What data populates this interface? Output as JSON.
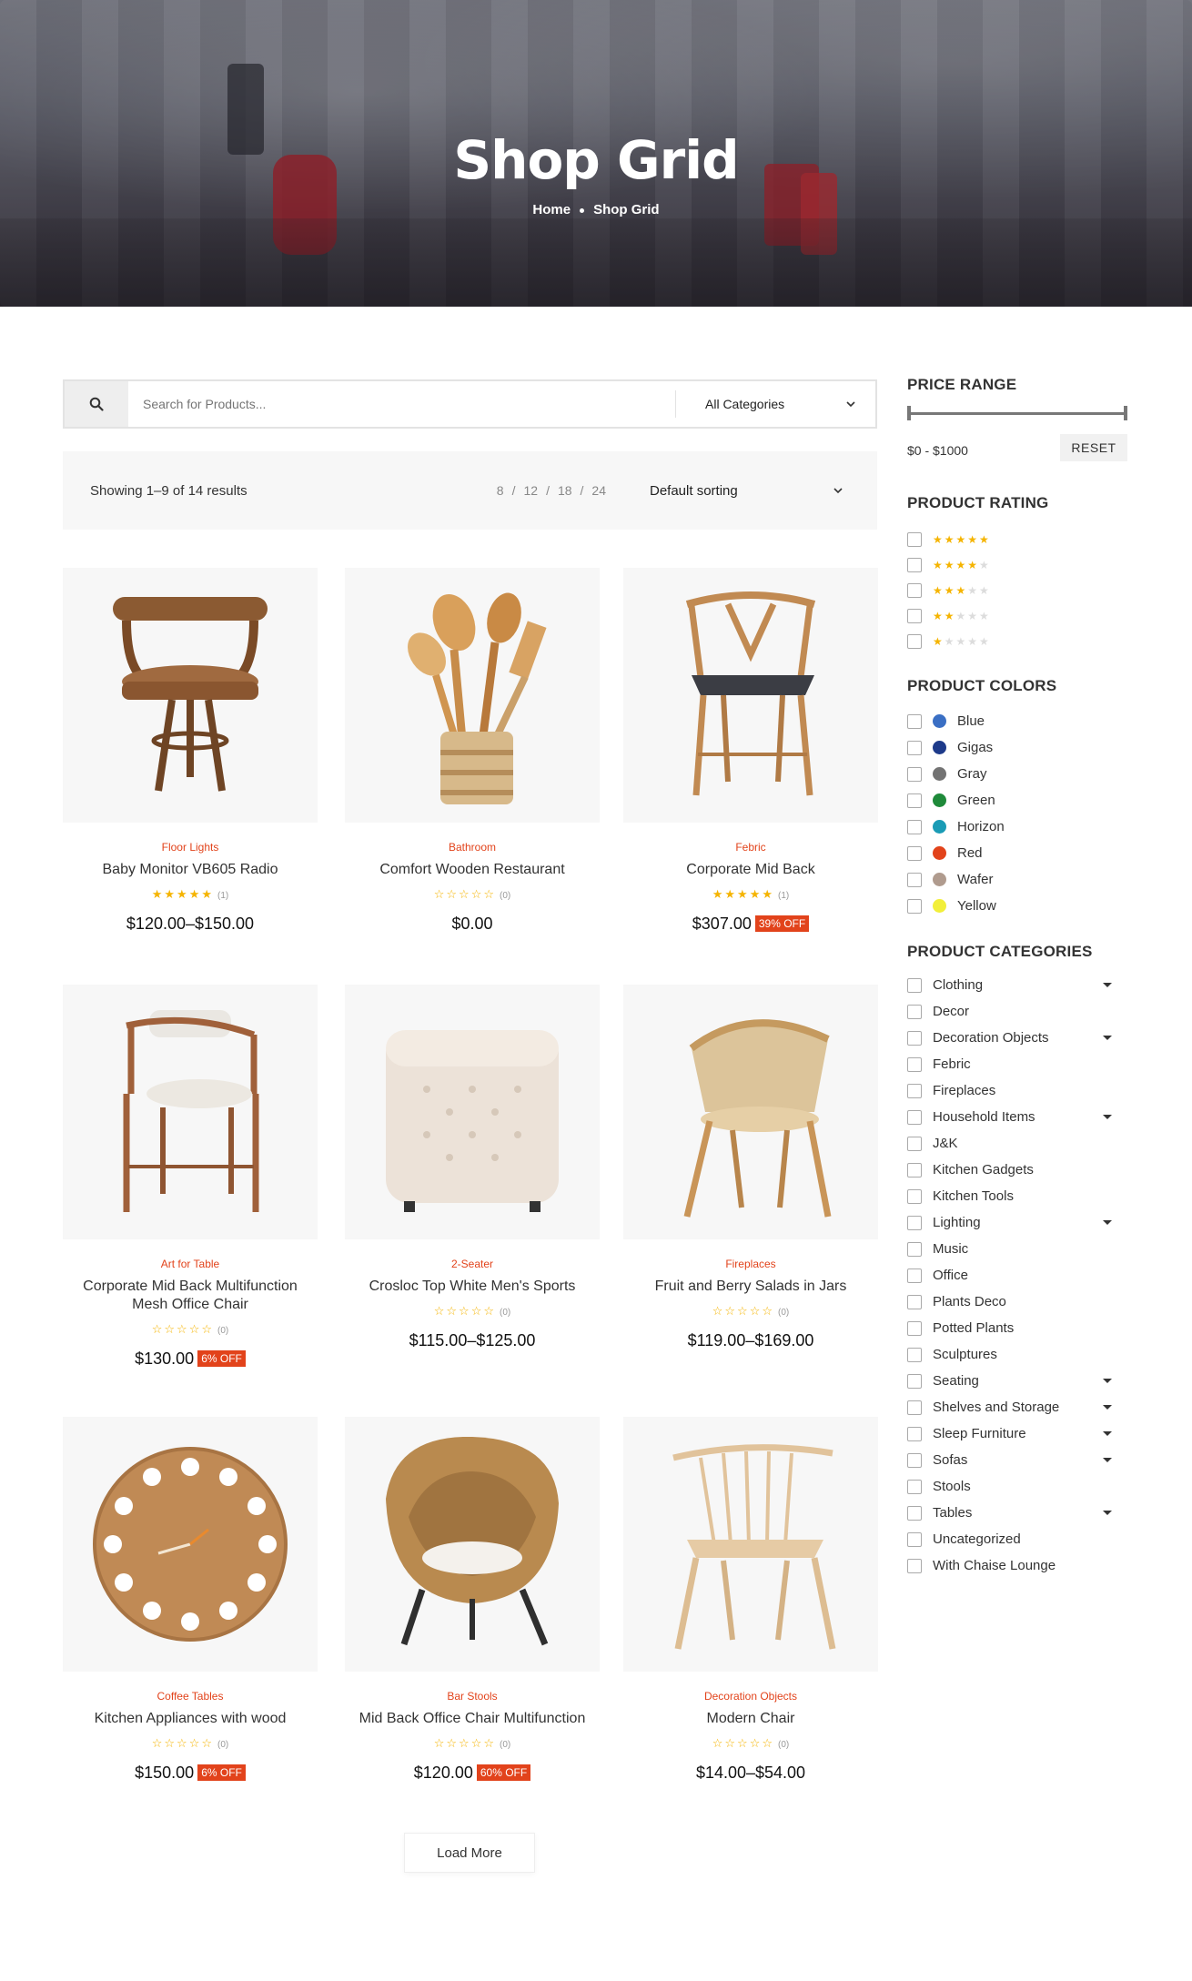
{
  "hero": {
    "title": "Shop Grid",
    "breadcrumb": [
      "Home",
      "Shop Grid"
    ]
  },
  "search": {
    "placeholder": "Search for Products...",
    "category": "All Categories"
  },
  "toolbar": {
    "showing": "Showing 1–9 of 14 results",
    "per_page": [
      "8",
      "12",
      "18",
      "24"
    ],
    "per_page_sep": "/",
    "sorting": "Default sorting"
  },
  "products": [
    {
      "category": "Floor Lights",
      "name": "Baby Monitor VB605 Radio",
      "stars": "★★★★★",
      "rating_count": "(1)",
      "price": "$120.00–$150.00",
      "badge": ""
    },
    {
      "category": "Bathroom",
      "name": "Comfort Wooden Restaurant",
      "stars": "☆☆☆☆☆",
      "rating_count": "(0)",
      "price": "$0.00",
      "badge": ""
    },
    {
      "category": "Febric",
      "name": "Corporate Mid Back",
      "stars": "★★★★★",
      "rating_count": "(1)",
      "price": "$307.00",
      "badge": "39% OFF"
    },
    {
      "category": "Art for Table",
      "name": "Corporate Mid Back Multifunction Mesh Office Chair",
      "stars": "☆☆☆☆☆",
      "rating_count": "(0)",
      "price": "$130.00",
      "badge": "6% OFF"
    },
    {
      "category": "2-Seater",
      "name": "Crosloc Top White Men's Sports",
      "stars": "☆☆☆☆☆",
      "rating_count": "(0)",
      "price": "$115.00–$125.00",
      "badge": ""
    },
    {
      "category": "Fireplaces",
      "name": "Fruit and Berry Salads in Jars",
      "stars": "☆☆☆☆☆",
      "rating_count": "(0)",
      "price": "$119.00–$169.00",
      "badge": ""
    },
    {
      "category": "Coffee Tables",
      "name": "Kitchen Appliances with wood",
      "stars": "☆☆☆☆☆",
      "rating_count": "(0)",
      "price": "$150.00",
      "badge": "6% OFF"
    },
    {
      "category": "Bar Stools",
      "name": "Mid Back Office Chair Multifunction",
      "stars": "☆☆☆☆☆",
      "rating_count": "(0)",
      "price": "$120.00",
      "badge": "60% OFF"
    },
    {
      "category": "Decoration Objects",
      "name": "Modern Chair",
      "stars": "☆☆☆☆☆",
      "rating_count": "(0)",
      "price": "$14.00–$54.00",
      "badge": ""
    }
  ],
  "load_more": "Load More",
  "sidebar": {
    "price_range": {
      "title": "PRICE RANGE",
      "text": "$0 - $1000",
      "reset": "RESET"
    },
    "rating": {
      "title": "PRODUCT RATING",
      "levels": [
        5,
        4,
        3,
        2,
        1
      ]
    },
    "colors": {
      "title": "PRODUCT COLORS",
      "items": [
        {
          "name": "Blue",
          "hex": "#3a6fc4"
        },
        {
          "name": "Gigas",
          "hex": "#1d3a8a"
        },
        {
          "name": "Gray",
          "hex": "#737373"
        },
        {
          "name": "Green",
          "hex": "#1f8a3a"
        },
        {
          "name": "Horizon",
          "hex": "#1a9bb5"
        },
        {
          "name": "Red",
          "hex": "#e2431b"
        },
        {
          "name": "Wafer",
          "hex": "#b09b8e"
        },
        {
          "name": "Yellow",
          "hex": "#f2ef3a"
        }
      ]
    },
    "categories": {
      "title": "PRODUCT CATEGORIES",
      "items": [
        {
          "name": "Clothing",
          "expand": true
        },
        {
          "name": "Decor",
          "expand": false
        },
        {
          "name": "Decoration Objects",
          "expand": true
        },
        {
          "name": "Febric",
          "expand": false
        },
        {
          "name": "Fireplaces",
          "expand": false
        },
        {
          "name": "Household Items",
          "expand": true
        },
        {
          "name": "J&K",
          "expand": false
        },
        {
          "name": "Kitchen Gadgets",
          "expand": false
        },
        {
          "name": "Kitchen Tools",
          "expand": false
        },
        {
          "name": "Lighting",
          "expand": true
        },
        {
          "name": "Music",
          "expand": false
        },
        {
          "name": "Office",
          "expand": false
        },
        {
          "name": "Plants Deco",
          "expand": false
        },
        {
          "name": "Potted Plants",
          "expand": false
        },
        {
          "name": "Sculptures",
          "expand": false
        },
        {
          "name": "Seating",
          "expand": true
        },
        {
          "name": "Shelves and Storage",
          "expand": true
        },
        {
          "name": "Sleep Furniture",
          "expand": true
        },
        {
          "name": "Sofas",
          "expand": true
        },
        {
          "name": "Stools",
          "expand": false
        },
        {
          "name": "Tables",
          "expand": true
        },
        {
          "name": "Uncategorized",
          "expand": false
        },
        {
          "name": "With Chaise Lounge",
          "expand": false
        }
      ]
    }
  }
}
